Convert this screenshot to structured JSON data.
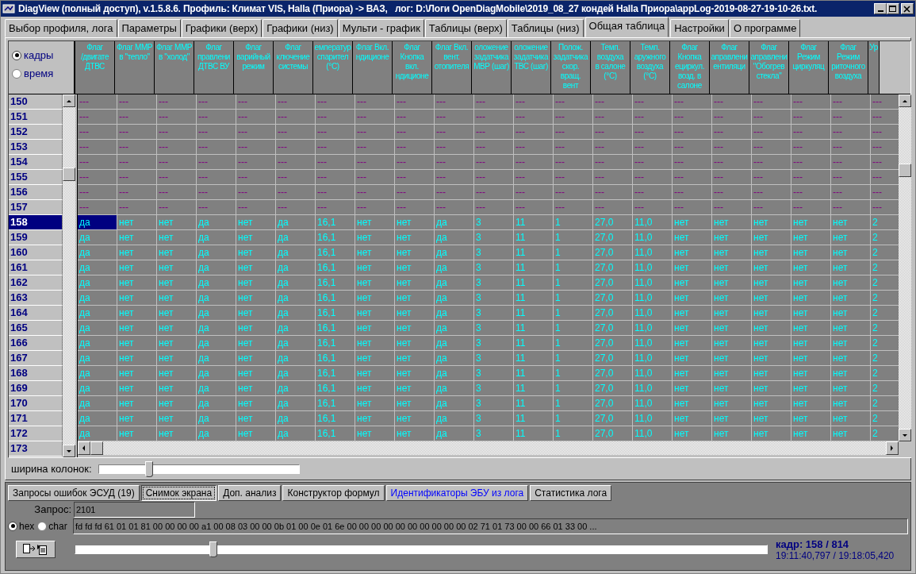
{
  "window": {
    "title": "DiagView (полный доступ), v.1.5.8.6. Профиль: Климат VIS, Halla (Приора) -> ВАЗ,   лог: D:\\Логи OpenDiagMobile\\2019_08_27 кондей Halla Приора\\appLog-2019-08-27-19-10-26.txt."
  },
  "tabs": [
    {
      "label": "Выбор профиля, лога",
      "selected": false
    },
    {
      "label": "Параметры",
      "selected": false
    },
    {
      "label": "Графики (верх)",
      "selected": false
    },
    {
      "label": "Графики (низ)",
      "selected": false
    },
    {
      "label": "Мульти - график",
      "selected": false
    },
    {
      "label": "Таблицы (верх)",
      "selected": false
    },
    {
      "label": "Таблицы (низ)",
      "selected": false
    },
    {
      "label": "Общая таблица",
      "selected": true
    },
    {
      "label": "Настройки",
      "selected": false
    },
    {
      "label": "О программе",
      "selected": false
    }
  ],
  "table": {
    "mode_options": [
      {
        "label": "кадры",
        "selected": true
      },
      {
        "label": "время",
        "selected": false
      }
    ],
    "columns": [
      "Флаг\n/двигате\nДТВС",
      "Флаг ММР\nв \"тепло\"",
      "Флаг ММР\nв \"холод\"",
      "Флаг\nправлени\nДТВС ВУ",
      "Флаг\nварийный\nрежим",
      "Флаг\nключение\nсистемы",
      "емператур\nспарител\n(°C)",
      "Флаг Вкл.\nндиционе",
      "Флаг\nКнопка\nвкл.\nндиционе",
      "Флаг Вкл.\nвент.\nотопителя",
      "оложение\nзадатчика\nМВР (шаг)",
      "оложение\nзадатчика\nТВС (шаг)",
      "Полож.\nзадатчика\nскор.\nвращ.\nвент",
      "Темп.\nвоздуха\nв салоне\n(°C)",
      "Темп.\nаружного\nвоздуха\n(°C)",
      "Флаг\nКнопка\nециркул.\nвозд. в\nсалоне",
      "Флаг\nаправлени\nентиляци",
      "Флаг\nаправлени\n\"Обогрев\nстекла\"",
      "Флаг\nРежим\nциркуляц",
      "Флаг\nРежим\nриточного\nвоздуха",
      "Ур"
    ],
    "rows": [
      {
        "number": "150",
        "selected": false,
        "kind": "empty",
        "cells": [
          "---",
          "---",
          "---",
          "---",
          "---",
          "---",
          "---",
          "---",
          "---",
          "---",
          "---",
          "---",
          "---",
          "---",
          "---",
          "---",
          "---",
          "---",
          "---",
          "---",
          "---"
        ]
      },
      {
        "number": "151",
        "selected": false,
        "kind": "empty",
        "cells": [
          "---",
          "---",
          "---",
          "---",
          "---",
          "---",
          "---",
          "---",
          "---",
          "---",
          "---",
          "---",
          "---",
          "---",
          "---",
          "---",
          "---",
          "---",
          "---",
          "---",
          "---"
        ]
      },
      {
        "number": "152",
        "selected": false,
        "kind": "empty",
        "cells": [
          "---",
          "---",
          "---",
          "---",
          "---",
          "---",
          "---",
          "---",
          "---",
          "---",
          "---",
          "---",
          "---",
          "---",
          "---",
          "---",
          "---",
          "---",
          "---",
          "---",
          "---"
        ]
      },
      {
        "number": "153",
        "selected": false,
        "kind": "empty",
        "cells": [
          "---",
          "---",
          "---",
          "---",
          "---",
          "---",
          "---",
          "---",
          "---",
          "---",
          "---",
          "---",
          "---",
          "---",
          "---",
          "---",
          "---",
          "---",
          "---",
          "---",
          "---"
        ]
      },
      {
        "number": "154",
        "selected": false,
        "kind": "empty",
        "cells": [
          "---",
          "---",
          "---",
          "---",
          "---",
          "---",
          "---",
          "---",
          "---",
          "---",
          "---",
          "---",
          "---",
          "---",
          "---",
          "---",
          "---",
          "---",
          "---",
          "---",
          "---"
        ]
      },
      {
        "number": "155",
        "selected": false,
        "kind": "empty",
        "cells": [
          "---",
          "---",
          "---",
          "---",
          "---",
          "---",
          "---",
          "---",
          "---",
          "---",
          "---",
          "---",
          "---",
          "---",
          "---",
          "---",
          "---",
          "---",
          "---",
          "---",
          "---"
        ]
      },
      {
        "number": "156",
        "selected": false,
        "kind": "empty",
        "cells": [
          "---",
          "---",
          "---",
          "---",
          "---",
          "---",
          "---",
          "---",
          "---",
          "---",
          "---",
          "---",
          "---",
          "---",
          "---",
          "---",
          "---",
          "---",
          "---",
          "---",
          "---"
        ]
      },
      {
        "number": "157",
        "selected": false,
        "kind": "empty",
        "cells": [
          "---",
          "---",
          "---",
          "---",
          "---",
          "---",
          "---",
          "---",
          "---",
          "---",
          "---",
          "---",
          "---",
          "---",
          "---",
          "---",
          "---",
          "---",
          "---",
          "---",
          "---"
        ]
      },
      {
        "number": "158",
        "selected": true,
        "kind": "value",
        "cells": [
          "да",
          "нет",
          "нет",
          "да",
          "нет",
          "да",
          "16,1",
          "нет",
          "нет",
          "да",
          "3",
          "11",
          "1",
          "27,0",
          "11,0",
          "нет",
          "нет",
          "нет",
          "нет",
          "нет",
          "2"
        ]
      },
      {
        "number": "159",
        "selected": false,
        "kind": "value",
        "cells": [
          "да",
          "нет",
          "нет",
          "да",
          "нет",
          "да",
          "16,1",
          "нет",
          "нет",
          "да",
          "3",
          "11",
          "1",
          "27,0",
          "11,0",
          "нет",
          "нет",
          "нет",
          "нет",
          "нет",
          "2"
        ]
      },
      {
        "number": "160",
        "selected": false,
        "kind": "value",
        "cells": [
          "да",
          "нет",
          "нет",
          "да",
          "нет",
          "да",
          "16,1",
          "нет",
          "нет",
          "да",
          "3",
          "11",
          "1",
          "27,0",
          "11,0",
          "нет",
          "нет",
          "нет",
          "нет",
          "нет",
          "2"
        ]
      },
      {
        "number": "161",
        "selected": false,
        "kind": "value",
        "cells": [
          "да",
          "нет",
          "нет",
          "да",
          "нет",
          "да",
          "16,1",
          "нет",
          "нет",
          "да",
          "3",
          "11",
          "1",
          "27,0",
          "11,0",
          "нет",
          "нет",
          "нет",
          "нет",
          "нет",
          "2"
        ]
      },
      {
        "number": "162",
        "selected": false,
        "kind": "value",
        "cells": [
          "да",
          "нет",
          "нет",
          "да",
          "нет",
          "да",
          "16,1",
          "нет",
          "нет",
          "да",
          "3",
          "11",
          "1",
          "27,0",
          "11,0",
          "нет",
          "нет",
          "нет",
          "нет",
          "нет",
          "2"
        ]
      },
      {
        "number": "163",
        "selected": false,
        "kind": "value",
        "cells": [
          "да",
          "нет",
          "нет",
          "да",
          "нет",
          "да",
          "16,1",
          "нет",
          "нет",
          "да",
          "3",
          "11",
          "1",
          "27,0",
          "11,0",
          "нет",
          "нет",
          "нет",
          "нет",
          "нет",
          "2"
        ]
      },
      {
        "number": "164",
        "selected": false,
        "kind": "value",
        "cells": [
          "да",
          "нет",
          "нет",
          "да",
          "нет",
          "да",
          "16,1",
          "нет",
          "нет",
          "да",
          "3",
          "11",
          "1",
          "27,0",
          "11,0",
          "нет",
          "нет",
          "нет",
          "нет",
          "нет",
          "2"
        ]
      },
      {
        "number": "165",
        "selected": false,
        "kind": "value",
        "cells": [
          "да",
          "нет",
          "нет",
          "да",
          "нет",
          "да",
          "16,1",
          "нет",
          "нет",
          "да",
          "3",
          "11",
          "1",
          "27,0",
          "11,0",
          "нет",
          "нет",
          "нет",
          "нет",
          "нет",
          "2"
        ]
      },
      {
        "number": "166",
        "selected": false,
        "kind": "value",
        "cells": [
          "да",
          "нет",
          "нет",
          "да",
          "нет",
          "да",
          "16,1",
          "нет",
          "нет",
          "да",
          "3",
          "11",
          "1",
          "27,0",
          "11,0",
          "нет",
          "нет",
          "нет",
          "нет",
          "нет",
          "2"
        ]
      },
      {
        "number": "167",
        "selected": false,
        "kind": "value",
        "cells": [
          "да",
          "нет",
          "нет",
          "да",
          "нет",
          "да",
          "16,1",
          "нет",
          "нет",
          "да",
          "3",
          "11",
          "1",
          "27,0",
          "11,0",
          "нет",
          "нет",
          "нет",
          "нет",
          "нет",
          "2"
        ]
      },
      {
        "number": "168",
        "selected": false,
        "kind": "value",
        "cells": [
          "да",
          "нет",
          "нет",
          "да",
          "нет",
          "да",
          "16,1",
          "нет",
          "нет",
          "да",
          "3",
          "11",
          "1",
          "27,0",
          "11,0",
          "нет",
          "нет",
          "нет",
          "нет",
          "нет",
          "2"
        ]
      },
      {
        "number": "169",
        "selected": false,
        "kind": "value",
        "cells": [
          "да",
          "нет",
          "нет",
          "да",
          "нет",
          "да",
          "16,1",
          "нет",
          "нет",
          "да",
          "3",
          "11",
          "1",
          "27,0",
          "11,0",
          "нет",
          "нет",
          "нет",
          "нет",
          "нет",
          "2"
        ]
      },
      {
        "number": "170",
        "selected": false,
        "kind": "value",
        "cells": [
          "да",
          "нет",
          "нет",
          "да",
          "нет",
          "да",
          "16,1",
          "нет",
          "нет",
          "да",
          "3",
          "11",
          "1",
          "27,0",
          "11,0",
          "нет",
          "нет",
          "нет",
          "нет",
          "нет",
          "2"
        ]
      },
      {
        "number": "171",
        "selected": false,
        "kind": "value",
        "cells": [
          "да",
          "нет",
          "нет",
          "да",
          "нет",
          "да",
          "16,1",
          "нет",
          "нет",
          "да",
          "3",
          "11",
          "1",
          "27,0",
          "11,0",
          "нет",
          "нет",
          "нет",
          "нет",
          "нет",
          "2"
        ]
      },
      {
        "number": "172",
        "selected": false,
        "kind": "value",
        "cells": [
          "да",
          "нет",
          "нет",
          "да",
          "нет",
          "да",
          "16,1",
          "нет",
          "нет",
          "да",
          "3",
          "11",
          "1",
          "27,0",
          "11,0",
          "нет",
          "нет",
          "нет",
          "нет",
          "нет",
          "2"
        ]
      },
      {
        "number": "173",
        "selected": false
      }
    ]
  },
  "column_width": {
    "label": "ширина колонок:",
    "level": 0.25
  },
  "bottom_tabs": [
    {
      "label": "Запросы ошибок ЭСУД (19)",
      "selected": false,
      "highlighted": false
    },
    {
      "label": "Снимок экрана",
      "selected": true,
      "highlighted": false
    },
    {
      "label": "Доп. анализ",
      "selected": false,
      "highlighted": false
    },
    {
      "label": "Конструктор формул",
      "selected": false,
      "highlighted": false
    },
    {
      "label": "Идентификаторы ЭБУ из лога",
      "selected": false,
      "highlighted": true
    },
    {
      "label": "Статистика лога",
      "selected": false,
      "highlighted": false
    }
  ],
  "request": {
    "label": "Запрос:",
    "value": "2101"
  },
  "encoding_options": [
    {
      "label": "hex",
      "selected": true
    },
    {
      "label": "char",
      "selected": false
    }
  ],
  "response": {
    "value": "fd fd fd 61 01 01 81 00 00 00 00 a1 00 08 03 00 00 0b 01 00 0e 01 6e 00 00 00 00 00 00 00 00 00 00 02 71 01 73 00 00 66 01 33 00 ..."
  },
  "frame_slider": {
    "level": 0.2
  },
  "status": {
    "frame": "кадр: 158 / 814",
    "time": "19:11:40,797 / 19:18:05,420"
  }
}
